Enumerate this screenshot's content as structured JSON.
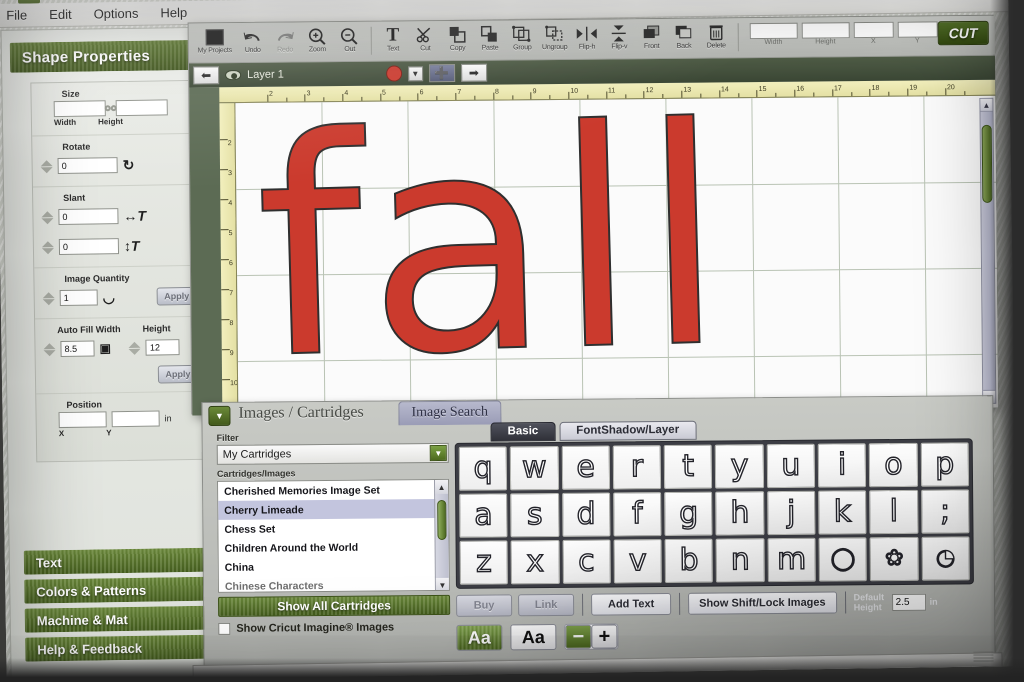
{
  "menubar": {
    "items": [
      "File",
      "Edit",
      "Options",
      "Help"
    ]
  },
  "shape_properties": {
    "title": "Shape Properties",
    "size": {
      "label": "Size",
      "width_label": "Width",
      "height_label": "Height",
      "width_value": "",
      "height_value": ""
    },
    "rotate": {
      "label": "Rotate",
      "value": "0"
    },
    "slant": {
      "label": "Slant",
      "horizontal_value": "0",
      "vertical_value": "0"
    },
    "image_quantity": {
      "label": "Image Quantity",
      "value": "1",
      "apply_label": "Apply"
    },
    "auto_fill": {
      "width_label": "Auto Fill Width",
      "width_value": "8.5",
      "height_label": "Height",
      "height_value": "12",
      "apply_label": "Apply"
    },
    "position": {
      "label": "Position",
      "x_label": "X",
      "y_label": "Y",
      "x_value": "",
      "y_value": "",
      "unit": "in"
    },
    "collapse_icon": "chevron-left-icon"
  },
  "green_tabs": [
    {
      "label": "Text"
    },
    {
      "label": "Colors & Patterns"
    },
    {
      "label": "Machine & Mat"
    },
    {
      "label": "Help & Feedback"
    }
  ],
  "toolbar": {
    "tools": [
      {
        "label": "My Projects",
        "icon": "project-square-icon",
        "dim": false
      },
      {
        "label": "Undo",
        "icon": "undo-arrow-icon",
        "dim": false
      },
      {
        "label": "Redo",
        "icon": "redo-arrow-icon",
        "dim": true
      },
      {
        "label": "Zoom",
        "icon": "zoom-in-icon",
        "dim": false
      },
      {
        "label": "Out",
        "icon": "zoom-out-icon",
        "dim": false
      },
      {
        "label": "Text",
        "icon": "text-t-icon",
        "dim": false
      },
      {
        "label": "Cut",
        "icon": "scissors-icon",
        "dim": false
      },
      {
        "label": "Copy",
        "icon": "copy-icon",
        "dim": false
      },
      {
        "label": "Paste",
        "icon": "paste-icon",
        "dim": false
      },
      {
        "label": "Group",
        "icon": "group-icon",
        "dim": false
      },
      {
        "label": "Ungroup",
        "icon": "ungroup-icon",
        "dim": false
      },
      {
        "label": "Flip-h",
        "icon": "flip-horizontal-icon",
        "dim": false
      },
      {
        "label": "Flip-v",
        "icon": "flip-vertical-icon",
        "dim": false
      },
      {
        "label": "Front",
        "icon": "bring-front-icon",
        "dim": false
      },
      {
        "label": "Back",
        "icon": "send-back-icon",
        "dim": false
      },
      {
        "label": "Delete",
        "icon": "trash-icon",
        "dim": false
      }
    ],
    "width_label": "Width",
    "height_label": "Height",
    "width_value": "",
    "height_value": "",
    "x_label": "X",
    "y_label": "Y",
    "x_value": "",
    "y_value": "",
    "cut_label": "CUT"
  },
  "layerbar": {
    "back_icon": "arrow-left-icon",
    "eye_icon": "visibility-eye-icon",
    "layer_name": "Layer 1",
    "color_swatch": "#cc3b2f",
    "dropdown_icon": "chevron-down-icon",
    "add_icon": "plus-icon",
    "forward_icon": "arrow-right-icon"
  },
  "canvas": {
    "artwork_text": "fall",
    "artwork_color": "#cb3a2d",
    "ruler_h_numbers": [
      "2",
      "3",
      "4",
      "5",
      "6",
      "7",
      "8",
      "9",
      "10",
      "11",
      "12",
      "13",
      "14",
      "15",
      "16",
      "17",
      "18",
      "19",
      "20"
    ],
    "ruler_v_numbers": [
      "2",
      "3",
      "4",
      "5",
      "6",
      "7",
      "8",
      "9",
      "10"
    ],
    "scroll_up_icon": "chevron-up-icon",
    "scroll_down_icon": "chevron-down-icon"
  },
  "bottom_panel": {
    "collapse_icon": "chevron-down-icon",
    "tab_images_cartridges": "Images / Cartridges",
    "tab_image_search": "Image Search",
    "filter_label": "Filter",
    "filter_value": "My Cartridges",
    "filter_arrow_icon": "chevron-down-icon",
    "list_label": "Cartridges/Images",
    "cartridges": [
      "Cherished Memories Image Set",
      "Cherry Limeade",
      "Chess Set",
      "Children Around the World",
      "China",
      "Chinese Characters"
    ],
    "selected_cartridge": "Cherry Limeade",
    "show_all_label": "Show All Cartridges",
    "checkbox_label": "Show Cricut Imagine® Images",
    "checkbox_checked": false
  },
  "keyboard": {
    "tabs": [
      {
        "label": "Basic",
        "active": true
      },
      {
        "label": "FontShadow/Layer",
        "active": false
      }
    ],
    "rows": [
      [
        "q",
        "w",
        "e",
        "r",
        "t",
        "y",
        "u",
        "i",
        "o",
        "p"
      ],
      [
        "a",
        "s",
        "d",
        "f",
        "g",
        "h",
        "j",
        "k",
        "l",
        ";"
      ],
      [
        "z",
        "x",
        "c",
        "v",
        "b",
        "n",
        "m",
        "◯",
        "❀",
        "◔"
      ]
    ],
    "buttons": {
      "buy": "Buy",
      "link": "Link",
      "add_text": "Add Text",
      "show_shift_lock": "Show Shift/Lock Images",
      "default_height_label": "Default Height",
      "default_height_value": "2.5",
      "default_height_unit": "in",
      "case_upper": "Aa",
      "case_lower": "Aa",
      "minus": "−",
      "plus": "+"
    }
  }
}
